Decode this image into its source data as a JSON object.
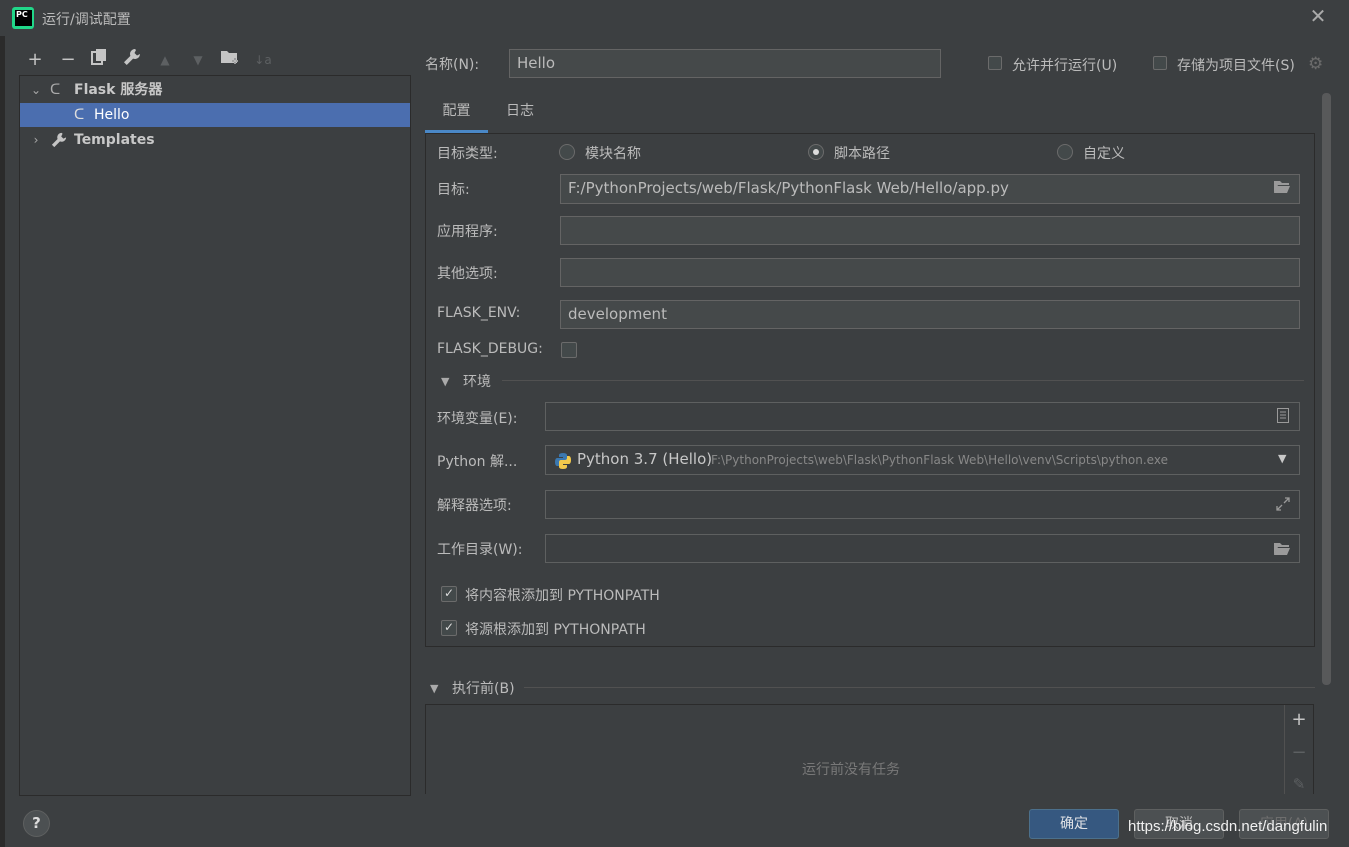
{
  "window": {
    "title": "运行/调试配置",
    "logo_text": "PC"
  },
  "toolbar": {
    "add": "+",
    "remove": "−",
    "copy": "❐",
    "edit": "🔧",
    "up": "▲",
    "down": "▼",
    "folder": "📁",
    "sort": "↓a"
  },
  "tree": {
    "group": "Flask 服务器",
    "child": "Hello",
    "templates": "Templates"
  },
  "header": {
    "name_label": "名称(N):",
    "name_value": "Hello",
    "parallel_label": "允许并行运行(U)",
    "store_label": "存储为项目文件(S)"
  },
  "tabs": [
    {
      "label": "配置"
    },
    {
      "label": "日志"
    }
  ],
  "config": {
    "target_type_label": "目标类型:",
    "radio_module": "模块名称",
    "radio_script": "脚本路径",
    "radio_custom": "自定义",
    "target_label": "目标:",
    "target_value": "F:/PythonProjects/web/Flask/PythonFlask Web/Hello/app.py",
    "app_label": "应用程序:",
    "app_value": "",
    "options_label": "其他选项:",
    "options_value": "",
    "env_label": "FLASK_ENV:",
    "env_value": "development",
    "debug_label": "FLASK_DEBUG:",
    "env_section": "环境",
    "env_vars_label": "环境变量(E):",
    "env_vars_value": "",
    "interpreter_label": "Python 解...",
    "interpreter_name": "Python 3.7 (Hello)",
    "interpreter_path": "F:\\PythonProjects\\web\\Flask\\PythonFlask Web\\Hello\\venv\\Scripts\\python.exe",
    "interp_opts_label": "解释器选项:",
    "interp_opts_value": "",
    "workdir_label": "工作目录(W):",
    "workdir_value": "",
    "content_roots_label": "将内容根添加到 PYTHONPATH",
    "source_roots_label": "将源根添加到 PYTHONPATH"
  },
  "before": {
    "section": "执行前(B)",
    "empty": "运行前没有任务"
  },
  "buttons": {
    "ok": "确定",
    "cancel": "取消",
    "apply": "应用(A)",
    "help": "?"
  },
  "watermark": "https://blog.csdn.net/dangfulin",
  "colors": {
    "accent": "#4b6eaf",
    "tab_underline": "#4a88c7",
    "primary_button": "#365880"
  }
}
